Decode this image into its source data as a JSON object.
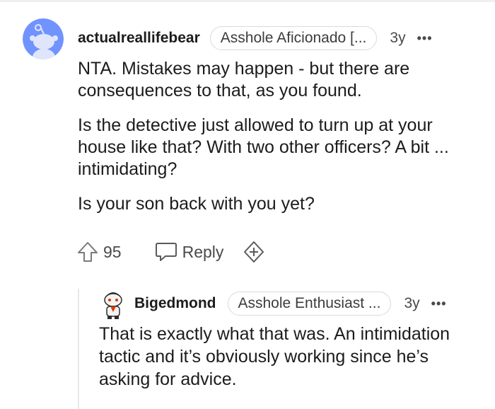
{
  "comments": [
    {
      "username": "actualreallifebear",
      "flair": "Asshole Aficionado [...",
      "age": "3y",
      "more": "•••",
      "paragraphs": [
        "NTA. Mistakes may happen - but there are consequences to that, as you found.",
        "Is the detective just allowed to turn up at your house like that? With two other officers? A bit ... intimidating?",
        "Is your son back with you yet?"
      ],
      "votes": "95",
      "reply_label": "Reply"
    },
    {
      "username": "Bigedmond",
      "flair": "Asshole Enthusiast ...",
      "age": "3y",
      "more": "•••",
      "paragraphs": [
        "That is exactly what that was. An intimidation tactic and it’s obviously working since he’s asking for advice."
      ]
    }
  ],
  "colors": {
    "avatar_bg": "#7193ff",
    "text": "#1c1c1c",
    "muted": "#4a4a4a",
    "border": "#d7dadc"
  },
  "icons": [
    "snoo-avatar-icon",
    "upvote-arrow-icon",
    "reply-bubble-icon",
    "award-plus-icon",
    "more-dots-icon"
  ]
}
